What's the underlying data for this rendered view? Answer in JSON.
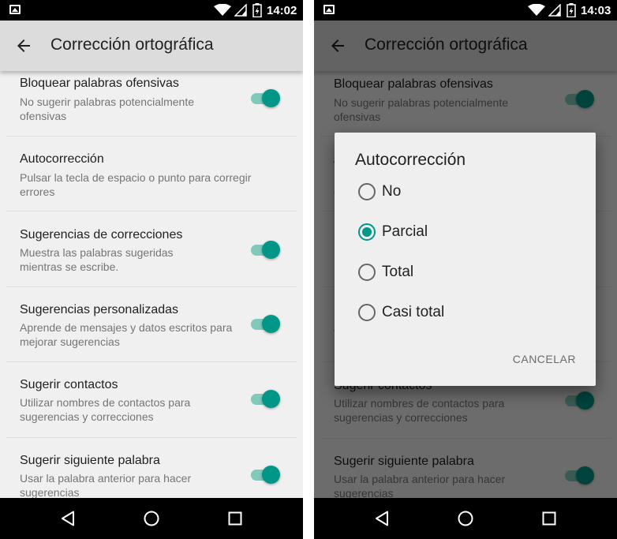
{
  "status_left": {
    "time": "14:02"
  },
  "status_right": {
    "time": "14:03"
  },
  "appbar": {
    "title": "Corrección ortográfica"
  },
  "settings": [
    {
      "title": "Bloquear palabras ofensivas",
      "subtitle": "No sugerir palabras potencialmente ofensivas",
      "toggle": true,
      "toggle_on": true
    },
    {
      "title": "Autocorrección",
      "subtitle": "Pulsar la tecla de espacio o punto para corregir errores",
      "toggle": false
    },
    {
      "title": "Sugerencias de correcciones",
      "subtitle": "Muestra las palabras sugeridas mientras se escribe.",
      "toggle": true,
      "toggle_on": true
    },
    {
      "title": "Sugerencias personalizadas",
      "subtitle": "Aprende de mensajes y datos escritos para mejorar sugerencias",
      "toggle": true,
      "toggle_on": true
    },
    {
      "title": "Sugerir contactos",
      "subtitle": "Utilizar nombres de contactos para sugerencias y correcciones",
      "toggle": true,
      "toggle_on": true
    },
    {
      "title": "Sugerir siguiente palabra",
      "subtitle": "Usar la palabra anterior para hacer sugerencias",
      "toggle": true,
      "toggle_on": true
    }
  ],
  "dialog": {
    "title": "Autocorrección",
    "options": [
      {
        "label": "No",
        "selected": false
      },
      {
        "label": "Parcial",
        "selected": true
      },
      {
        "label": "Total",
        "selected": false
      },
      {
        "label": "Casi total",
        "selected": false
      }
    ],
    "cancel_label": "CANCELAR"
  },
  "colors": {
    "accent": "#009688",
    "accent_track": "#80c9bb",
    "background": "#f0f0f0",
    "appbar": "#dcdcdc"
  }
}
